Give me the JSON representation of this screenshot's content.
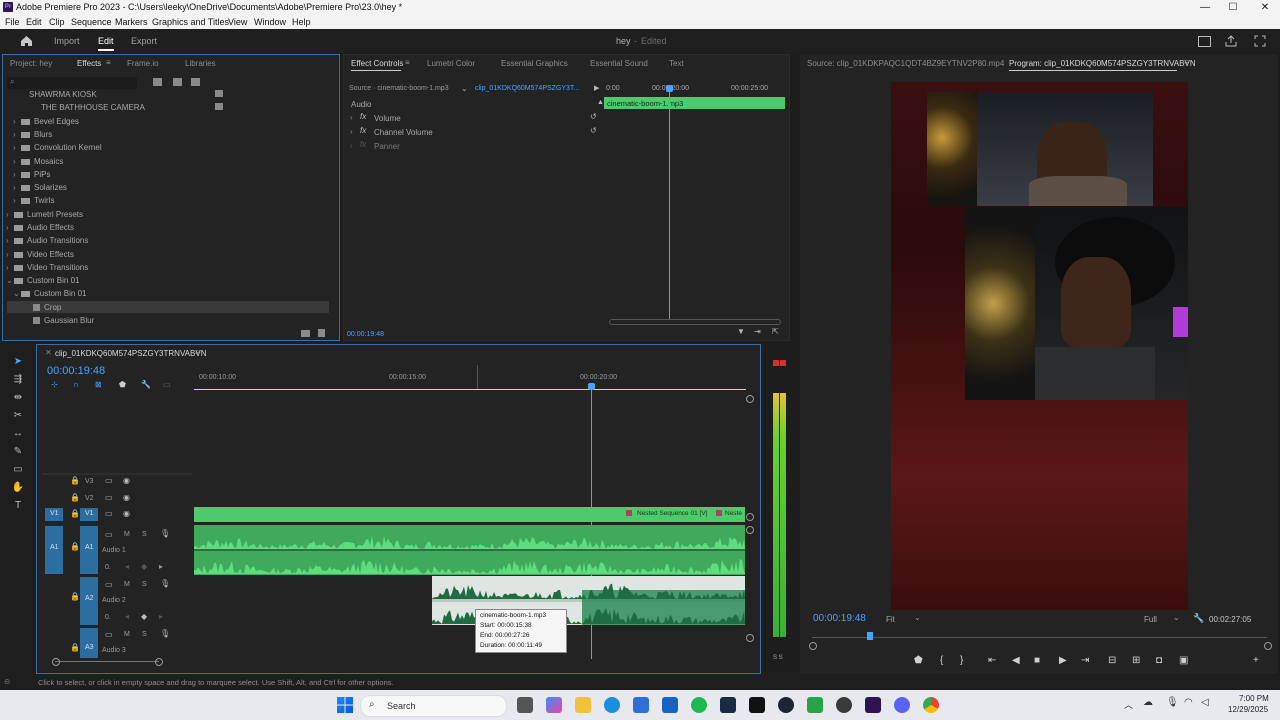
{
  "window": {
    "title": "Adobe Premiere Pro 2023 - C:\\Users\\leeky\\OneDrive\\Documents\\Adobe\\Premiere Pro\\23.0\\hey *",
    "logo_text": "Pr",
    "min": "—",
    "max": "☐",
    "close": "✕"
  },
  "menu": [
    "File",
    "Edit",
    "Clip",
    "Sequence",
    "Markers",
    "Graphics and Titles",
    "View",
    "Window",
    "Help"
  ],
  "workspace": {
    "home_icon": "home-icon",
    "tabs": [
      "Import",
      "Edit",
      "Export"
    ],
    "active_tab": "Edit",
    "project_name": "hey",
    "project_status": "Edited"
  },
  "effects_panel": {
    "tabs": [
      "Project: hey",
      "Effects",
      "Frame.io",
      "Libraries"
    ],
    "search_placeholder": "",
    "items": [
      {
        "label": "SHAWRMA KIOSK",
        "type": "preset"
      },
      {
        "label": "THE BATHHOUSE CAMERA",
        "type": "preset"
      },
      {
        "label": "Bevel Edges",
        "type": "folder"
      },
      {
        "label": "Blurs",
        "type": "folder"
      },
      {
        "label": "Convolution Kernel",
        "type": "folder"
      },
      {
        "label": "Mosaics",
        "type": "folder"
      },
      {
        "label": "PiPs",
        "type": "folder"
      },
      {
        "label": "Solarizes",
        "type": "folder"
      },
      {
        "label": "Twirls",
        "type": "folder"
      },
      {
        "label": "Lumetri Presets",
        "type": "folder"
      },
      {
        "label": "Audio Effects",
        "type": "folder"
      },
      {
        "label": "Audio Transitions",
        "type": "folder"
      },
      {
        "label": "Video Effects",
        "type": "folder"
      },
      {
        "label": "Video Transitions",
        "type": "folder"
      },
      {
        "label": "Custom Bin 01",
        "type": "folder"
      },
      {
        "label": "Custom Bin 01",
        "type": "folder"
      },
      {
        "label": "Crop",
        "type": "effect"
      },
      {
        "label": "Gaussian Blur",
        "type": "effect"
      }
    ]
  },
  "effect_controls": {
    "tabs": [
      "Effect Controls",
      "Lumetri Color",
      "Essential Graphics",
      "Essential Sound",
      "Text"
    ],
    "source": "Source · cinematic-boom-1.mp3",
    "clip": "clip_01KDKQ60M574PSZGY3T...",
    "section": "Audio",
    "rows": [
      "Volume",
      "Channel Volume",
      "Panner"
    ],
    "timecodes": [
      "0:00",
      "00:00:20:00",
      "00:00:25:00"
    ],
    "clip_bar": "cinematic-boom-1.mp3",
    "current_time": "00:00:19:48"
  },
  "program_monitor": {
    "source_tab": "Source: clip_01KDKPAQC1QDT4BZ9EYTNV2P80.mp4",
    "program_tab": "Program: clip_01KDKQ60M574PSZGY3TRNVABVN",
    "timecode": "00:00:19:48",
    "fit": "Fit",
    "quality": "Full",
    "duration": "00:02:27:05"
  },
  "timeline": {
    "sequence_name": "clip_01KDKQ60M574PSZGY3TRNVABVN",
    "timecode": "00:00:19:48",
    "ruler": [
      "00:00:10:00",
      "00:00:15:00",
      "00:00:20:00"
    ],
    "tracks": {
      "video": [
        "V3",
        "V2",
        "V1"
      ],
      "audio": [
        "A1",
        "A2",
        "A3"
      ],
      "audio_names": [
        "Audio 1",
        "Audio 2",
        "Audio 3"
      ],
      "m": "M",
      "s": "S",
      "zero": "0."
    },
    "nested_label": "Nested Sequence 01 [V]",
    "nested_label2": "Neste",
    "tooltip": {
      "name": "cinematic-boom-1.mp3",
      "start": "Start: 00:00:15:38",
      "end": "End: 00:00:27:26",
      "duration": "Duration: 00:00:11:49"
    },
    "meter_label": "S S"
  },
  "status_text": "Click to select, or click in empty space and drag to marquee select. Use Shift, Alt, and Ctrl for other options.",
  "taskbar": {
    "search": "Search",
    "time": "7:00 PM",
    "date": "12/29/2025"
  },
  "colors": {
    "accent": "#4aa3ff",
    "clip_green": "#4ec96d",
    "selected_clip": "#e9ece9"
  }
}
